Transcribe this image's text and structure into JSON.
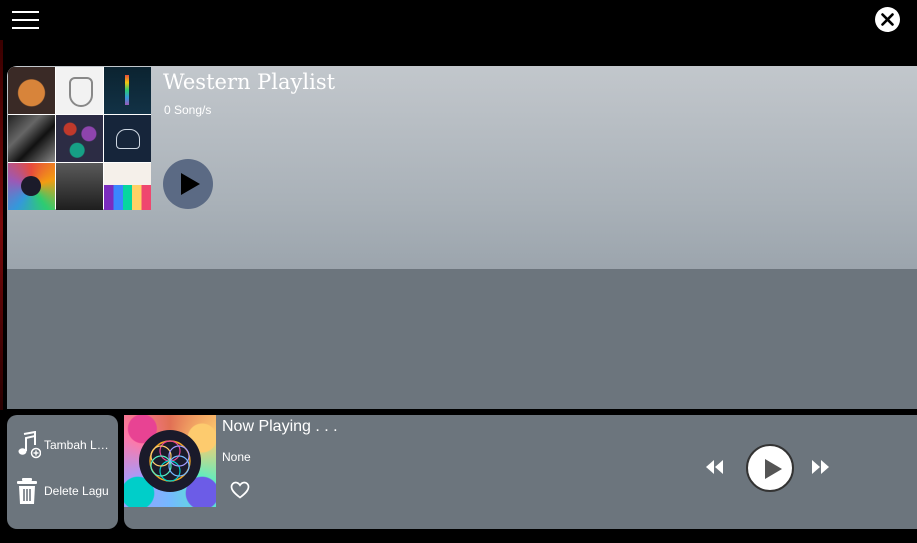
{
  "header": {
    "menu_icon": "hamburger-menu-icon",
    "close_icon": "close-icon"
  },
  "playlist": {
    "title": "Western Playlist",
    "song_count": "0 Song/s",
    "play_icon": "play-icon"
  },
  "side_actions": {
    "add_label": "Tambah Lagu",
    "add_icon": "music-note-add-icon",
    "delete_label": "Delete Lagu",
    "delete_icon": "trash-icon"
  },
  "player": {
    "title": "Now Playing . . .",
    "artist": "None",
    "favorite_icon": "heart-outline-icon",
    "prev_icon": "rewind-icon",
    "play_icon": "play-icon",
    "next_icon": "fast-forward-icon"
  },
  "colors": {
    "background": "#000000",
    "panel_bottom": "#6c757d",
    "play_button": "#5b6a84"
  }
}
